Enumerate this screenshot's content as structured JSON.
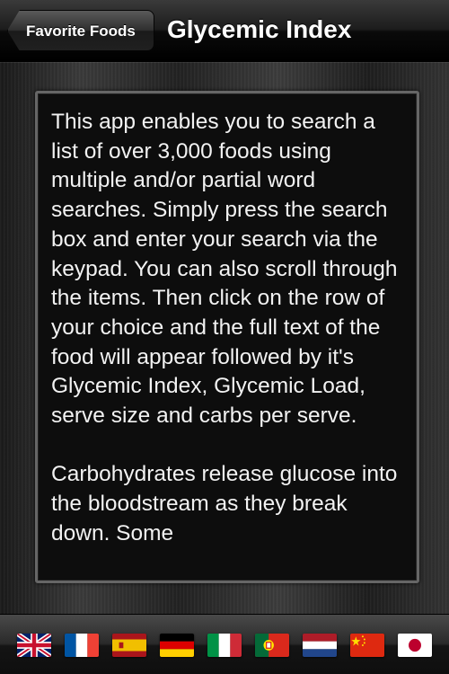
{
  "navbar": {
    "back_label": "Favorite Foods",
    "title": "Glycemic Index"
  },
  "content": {
    "paragraph_1": "This app enables you to search a list of over 3,000 foods using multiple and/or partial word searches. Simply press the search box and enter your search via the keypad. You can also scroll through the items. Then click on the row of your choice and the full text of the food will appear followed by it's Glycemic Index, Glycemic Load, serve size and carbs per serve.",
    "paragraph_2": "Carbohydrates release glucose into the bloodstream as they break down. Some"
  },
  "toolbar": {
    "flags": [
      {
        "icon": "uk-flag-icon"
      },
      {
        "icon": "france-flag-icon"
      },
      {
        "icon": "spain-flag-icon"
      },
      {
        "icon": "germany-flag-icon"
      },
      {
        "icon": "italy-flag-icon"
      },
      {
        "icon": "portugal-flag-icon"
      },
      {
        "icon": "netherlands-flag-icon"
      },
      {
        "icon": "china-flag-icon"
      },
      {
        "icon": "japan-flag-icon"
      }
    ]
  },
  "colors": {
    "text": "#f2f2f2",
    "panel_background": "#0d0d0d",
    "panel_border": "#666666"
  }
}
